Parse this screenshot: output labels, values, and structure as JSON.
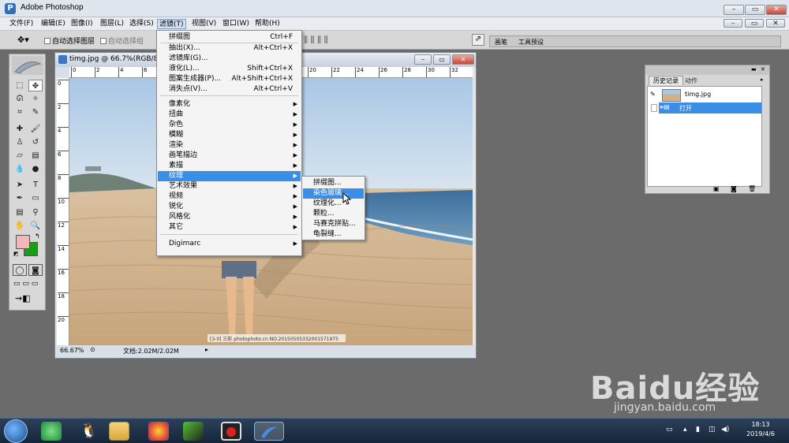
{
  "app": {
    "title": "Adobe Photoshop"
  },
  "menubar": [
    "文件(F)",
    "编辑(E)",
    "图像(I)",
    "图层(L)",
    "选择(S)",
    "滤镜(T)",
    "视图(V)",
    "窗口(W)",
    "帮助(H)"
  ],
  "options": {
    "auto_select_layer": "自动选择图层",
    "auto_select_group": "自动选择组"
  },
  "palette_well": {
    "tab1": "画笔",
    "tab2": "工具预设"
  },
  "document": {
    "title": "timg.jpg @ 66.7%(RGB/8#)",
    "zoom": "66.67%",
    "doc_size": "文档:2.02M/2.02M",
    "ruler_top": [
      "0",
      "2",
      "4",
      "6",
      "8",
      "10",
      "12",
      "14",
      "16",
      "18",
      "20",
      "22",
      "24",
      "26",
      "28",
      "30",
      "32"
    ],
    "ruler_left": [
      "0",
      "2",
      "4",
      "6",
      "8",
      "10",
      "12",
      "14",
      "16",
      "18",
      "20"
    ],
    "photo_caption": "[3-0] 三彩 photophoto.cn  NO.20150505332001571975"
  },
  "filter_menu": {
    "items": [
      {
        "label": "拼缀图",
        "shortcut": "Ctrl+F"
      },
      {
        "label": "抽出(X)...",
        "shortcut": "Alt+Ctrl+X"
      },
      {
        "label": "滤镜库(G)...",
        "shortcut": ""
      },
      {
        "label": "液化(L)...",
        "shortcut": "Shift+Ctrl+X"
      },
      {
        "label": "图案生成器(P)...",
        "shortcut": "Alt+Shift+Ctrl+X"
      },
      {
        "label": "消失点(V)...",
        "shortcut": "Alt+Ctrl+V"
      },
      {
        "label": "像素化",
        "shortcut": ""
      },
      {
        "label": "扭曲",
        "shortcut": ""
      },
      {
        "label": "杂色",
        "shortcut": ""
      },
      {
        "label": "模糊",
        "shortcut": ""
      },
      {
        "label": "渲染",
        "shortcut": ""
      },
      {
        "label": "画笔描边",
        "shortcut": ""
      },
      {
        "label": "素描",
        "shortcut": ""
      },
      {
        "label": "纹理",
        "shortcut": ""
      },
      {
        "label": "艺术效果",
        "shortcut": ""
      },
      {
        "label": "视频",
        "shortcut": ""
      },
      {
        "label": "锐化",
        "shortcut": ""
      },
      {
        "label": "风格化",
        "shortcut": ""
      },
      {
        "label": "其它",
        "shortcut": ""
      },
      {
        "label": "Digimarc",
        "shortcut": ""
      }
    ]
  },
  "texture_submenu": [
    "拼缀图...",
    "染色玻璃...",
    "纹理化...",
    "颗粒...",
    "马赛克拼贴...",
    "龟裂缝..."
  ],
  "history": {
    "tab_history": "历史记录",
    "tab_actions": "动作",
    "snapshot": "timg.jpg",
    "step": "打开"
  },
  "taskbar": {
    "time": "18:13",
    "date": "2019/4/6"
  },
  "watermark": {
    "logo": "Baidu经验",
    "url": "jingyan.baidu.com"
  },
  "colors": {
    "accent": "#3a8ee6",
    "foreground": "#f2b8b8",
    "background": "#16a016"
  }
}
